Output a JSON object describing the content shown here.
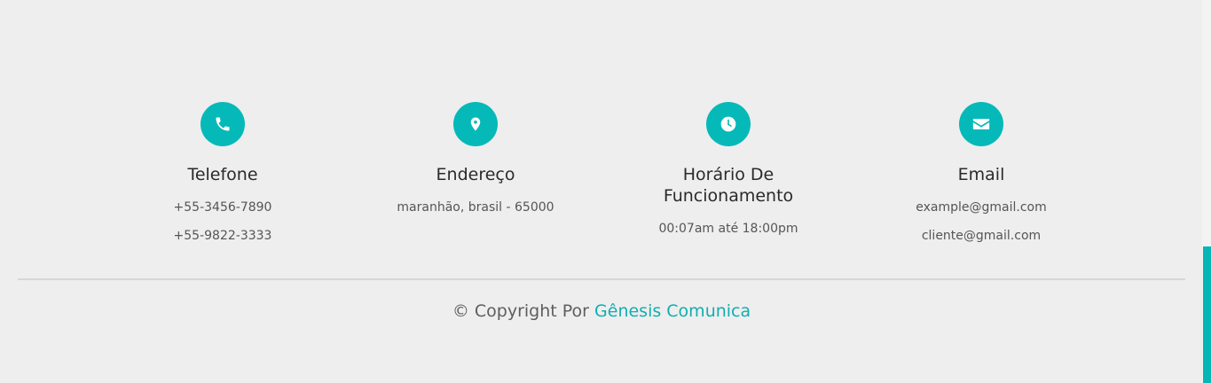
{
  "contacts": [
    {
      "icon": "phone-icon",
      "title": "Telefone",
      "lines": [
        "+55-3456-7890",
        "+55-9822-3333"
      ]
    },
    {
      "icon": "map-pin-icon",
      "title": "Endereço",
      "lines": [
        "maranhão, brasil - 65000"
      ]
    },
    {
      "icon": "clock-icon",
      "title_line1": "Horário De",
      "title_line2": "Funcionamento",
      "lines": [
        "00:07am até 18:00pm"
      ]
    },
    {
      "icon": "envelope-icon",
      "title": "Email",
      "lines": [
        "example@gmail.com",
        "cliente@gmail.com"
      ]
    }
  ],
  "footer": {
    "copyright_prefix": "© Copyright Por ",
    "brand": "Gênesis Comunica"
  },
  "colors": {
    "accent": "#06b9b9",
    "background": "#eeeeee",
    "brand_link": "#12aeb0"
  }
}
